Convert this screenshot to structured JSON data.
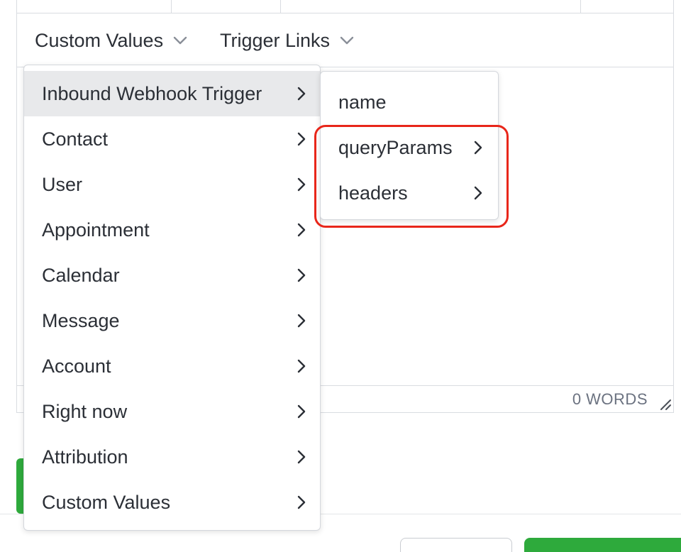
{
  "toolbar": {
    "custom_values_label": "Custom Values",
    "trigger_links_label": "Trigger Links"
  },
  "status": {
    "word_count": "0 WORDS"
  },
  "menu": {
    "items": [
      {
        "label": "Inbound Webhook Trigger",
        "active": true
      },
      {
        "label": "Contact"
      },
      {
        "label": "User"
      },
      {
        "label": "Appointment"
      },
      {
        "label": "Calendar"
      },
      {
        "label": "Message"
      },
      {
        "label": "Account"
      },
      {
        "label": "Right now"
      },
      {
        "label": "Attribution"
      },
      {
        "label": "Custom Values"
      }
    ]
  },
  "submenu": {
    "items": [
      {
        "label": "name",
        "has_children": false
      },
      {
        "label": "queryParams",
        "has_children": true
      },
      {
        "label": "headers",
        "has_children": true
      }
    ]
  },
  "colors": {
    "highlight": "#e8261a",
    "accent_green": "#2eaa3c",
    "active_item_bg": "#e8e9eb"
  }
}
